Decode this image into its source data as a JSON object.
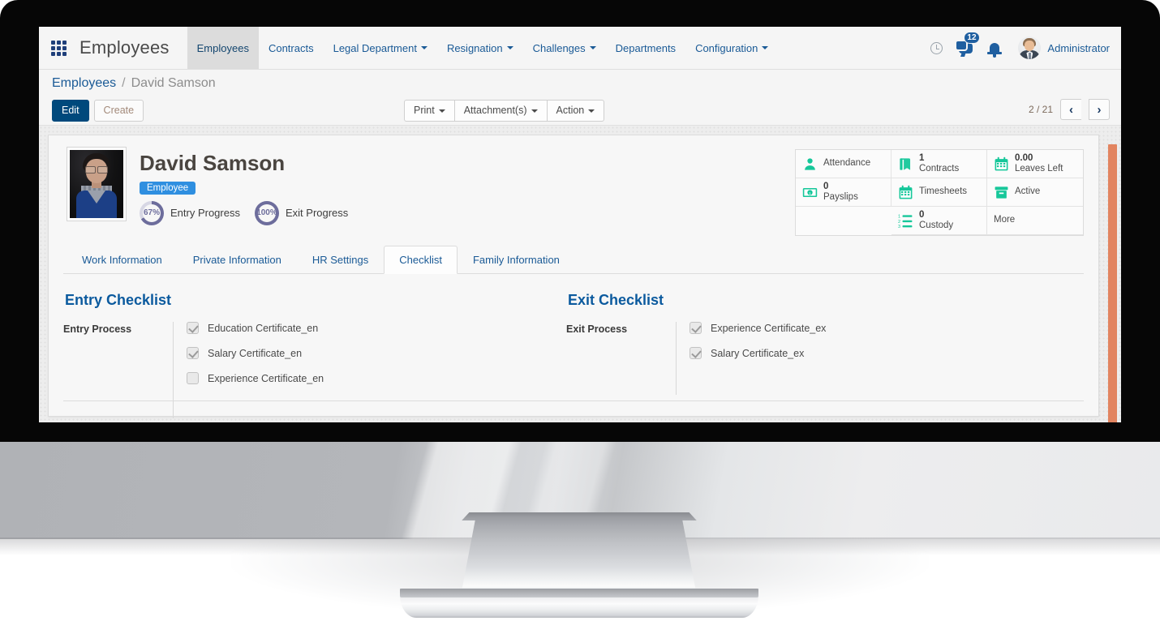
{
  "topnav": {
    "apps_icon": "grid-apps-icon",
    "app_title": "Employees",
    "menu": [
      {
        "label": "Employees",
        "has_caret": false,
        "active": true
      },
      {
        "label": "Contracts",
        "has_caret": false,
        "active": false
      },
      {
        "label": "Legal Department",
        "has_caret": true,
        "active": false
      },
      {
        "label": "Resignation",
        "has_caret": true,
        "active": false
      },
      {
        "label": "Challenges",
        "has_caret": true,
        "active": false
      },
      {
        "label": "Departments",
        "has_caret": false,
        "active": false
      },
      {
        "label": "Configuration",
        "has_caret": true,
        "active": false
      }
    ],
    "icons": {
      "clock": "clock-icon",
      "messages": "chat-bubble-icon",
      "messages_badge": "12",
      "bell": "bell-icon"
    },
    "user": "Administrator"
  },
  "breadcrumb": {
    "root": "Employees",
    "separator": "/",
    "current": "David Samson"
  },
  "controls": {
    "edit": "Edit",
    "create": "Create",
    "print": "Print",
    "attachments": "Attachment(s)",
    "action": "Action",
    "pager_text": "2 / 21",
    "prev": "‹",
    "next": "›"
  },
  "employee": {
    "name": "David Samson",
    "tag": "Employee",
    "entry_progress_value": "67%",
    "entry_progress_label": "Entry Progress",
    "entry_progress_pct": 67,
    "exit_progress_value": "100%",
    "exit_progress_label": "Exit Progress",
    "exit_progress_pct": 100
  },
  "stats": [
    {
      "icon": "person-icon",
      "value": "",
      "label": "Attendance"
    },
    {
      "icon": "book-icon",
      "value": "1",
      "label": "Contracts"
    },
    {
      "icon": "calendar-icon",
      "value": "0.00",
      "label": "Leaves Left"
    },
    {
      "icon": "money-icon",
      "value": "0",
      "label": "Payslips"
    },
    {
      "icon": "calendar-grid-icon",
      "value": "",
      "label": "Timesheets"
    },
    {
      "icon": "archive-icon",
      "value": "",
      "label": "Active"
    },
    {
      "icon": "",
      "value": "",
      "label": ""
    },
    {
      "icon": "numbered-list-icon",
      "value": "0",
      "label": "Custody"
    },
    {
      "icon": "",
      "value": "",
      "label": "More"
    }
  ],
  "tabs": [
    {
      "label": "Work Information",
      "active": false
    },
    {
      "label": "Private Information",
      "active": false
    },
    {
      "label": "HR Settings",
      "active": false
    },
    {
      "label": "Checklist",
      "active": true
    },
    {
      "label": "Family Information",
      "active": false
    }
  ],
  "checklist": {
    "entry": {
      "title": "Entry Checklist",
      "group_label": "Entry Process",
      "items": [
        {
          "label": "Education Certificate_en",
          "checked": true
        },
        {
          "label": "Salary Certificate_en",
          "checked": true
        },
        {
          "label": "Experience Certificate_en",
          "checked": false
        }
      ]
    },
    "exit": {
      "title": "Exit Checklist",
      "group_label": "Exit Process",
      "items": [
        {
          "label": "Experience Certificate_ex",
          "checked": true
        },
        {
          "label": "Salary Certificate_ex",
          "checked": true
        }
      ]
    }
  },
  "colors": {
    "accent_blue": "#1a5a96",
    "primary_button": "#00497c",
    "tag_blue": "#2f8fe0",
    "stat_green": "#16c79a",
    "progress_purple": "#6d6d9c",
    "scrollbar_orange": "#e28460",
    "heading_blue": "#0b5a9e"
  }
}
